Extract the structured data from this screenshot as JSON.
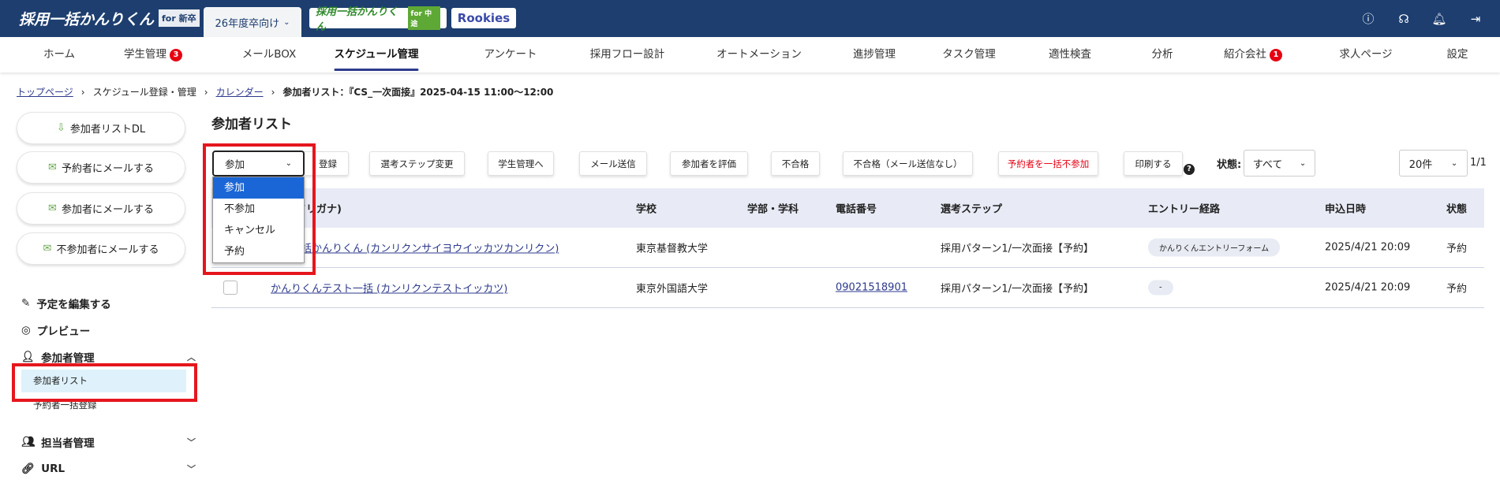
{
  "header": {
    "logo_main": "採用一括かんりくん",
    "logo_main_tag": "for 新卒",
    "year_selector": "26年度卒向け",
    "logo_mid": "採用一括かんりくん",
    "logo_mid_tag": "for 中途",
    "logo_rookies": "Rookies",
    "icons": [
      "help-icon",
      "support-headset-icon",
      "bell-icon",
      "logout-icon"
    ]
  },
  "nav": {
    "items": [
      {
        "label": "ホーム"
      },
      {
        "label": "学生管理",
        "badge": "3"
      },
      {
        "label": "メールBOX"
      },
      {
        "label": "スケジュール管理",
        "active": true
      },
      {
        "label": "アンケート"
      },
      {
        "label": "採用フロー設計"
      },
      {
        "label": "オートメーション"
      },
      {
        "label": "進捗管理"
      },
      {
        "label": "タスク管理"
      },
      {
        "label": "適性検査"
      },
      {
        "label": "分析"
      },
      {
        "label": "紹介会社",
        "badge": "1"
      },
      {
        "label": "求人ページ"
      },
      {
        "label": "設定"
      }
    ]
  },
  "breadcrumb": {
    "items": [
      "トップページ",
      "スケジュール登録・管理",
      "カレンダー",
      "参加者リスト：『CS_一次面接』2025-04-15 11:00〜12:00"
    ],
    "separator": "›"
  },
  "sidebar": {
    "buttons": [
      "参加者リストDL",
      "予約者にメールする",
      "参加者にメールする",
      "不参加者にメールする"
    ],
    "items": {
      "edit": "予定を編集する",
      "preview": "プレビュー",
      "participants": "参加者管理",
      "participant_list": "参加者リスト",
      "bulk_register": "予約者一括登録",
      "staff": "担当者管理",
      "url": "URL"
    }
  },
  "main": {
    "title": "参加者リスト",
    "state_select": {
      "value": "参加",
      "options": [
        "参加",
        "不参加",
        "キャンセル",
        "予約"
      ]
    },
    "toolbar": [
      "登録",
      "選考ステップ変更",
      "学生管理へ",
      "メール送信",
      "参加者を評価",
      "不合格",
      "不合格（メール送信なし）",
      "予約者を一括不参加",
      "印刷する"
    ],
    "danger_color": "#e60012",
    "status_label": "状態:",
    "status_value": "すべて",
    "per_page": "20件",
    "page": "1/1",
    "table": {
      "headers": [
        "氏名(フリガナ)",
        "学校",
        "学部・学科",
        "電話番号",
        "選考ステップ",
        "エントリー経路",
        "申込日時",
        "状態"
      ],
      "rows": [
        {
          "name": "採用一括かんりくん (カンリクンサイヨウイッカツカンリクン)",
          "school": "東京基督教大学",
          "faculty": "",
          "phone": "",
          "step": "採用パターン1/一次面接【予約】",
          "route": "かんりくんエントリーフォーム",
          "date": "2025/4/21 20:09",
          "status": "予約"
        },
        {
          "name": "かんりくんテスト一括 (カンリクンテストイッカツ)",
          "school": "東京外国語大学",
          "faculty": "",
          "phone": "09021518901",
          "step": "採用パターン1/一次面接【予約】",
          "route": "-",
          "date": "2025/4/21 20:09",
          "status": "予約"
        }
      ]
    }
  }
}
